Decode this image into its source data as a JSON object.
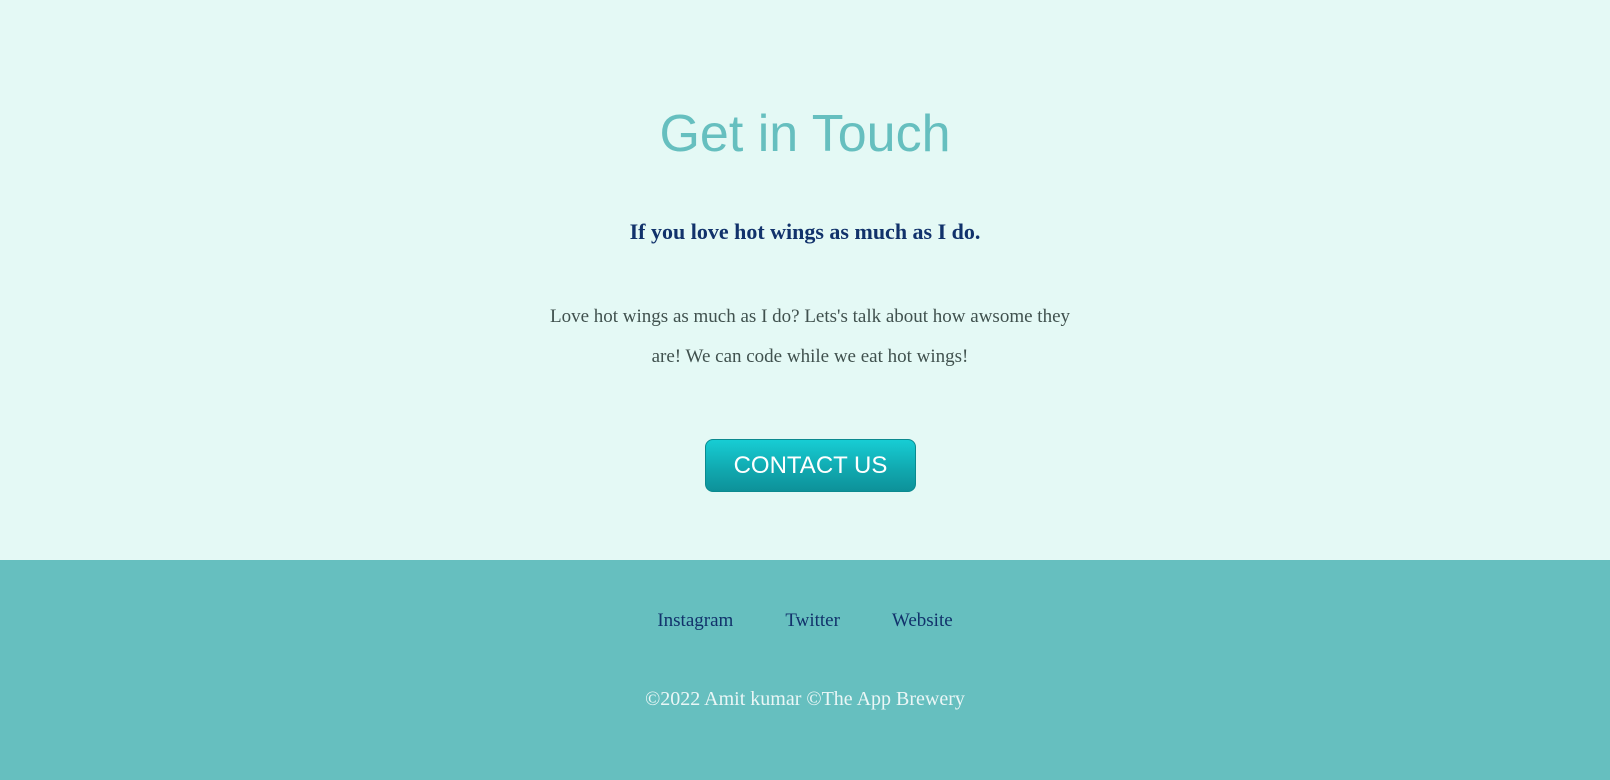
{
  "contact": {
    "title": "Get in Touch",
    "subtitle": "If you love hot wings as much as I do.",
    "body_line1": "Love hot wings as much as I do? Lets's talk about how awsome they",
    "body_line2": "are! We can code while we eat hot wings!",
    "button_label": "CONTACT US"
  },
  "footer": {
    "links": [
      "Instagram",
      "Twitter",
      "Website"
    ],
    "copyright": "©2022 Amit kumar ©The App Brewery"
  },
  "colors": {
    "background": "#e4f9f5",
    "title": "#66bfbf",
    "subtitle": "#11326b",
    "body_text": "#40514e",
    "button": "#11aab1",
    "footer_background": "#66bfbf",
    "footer_link": "#11326b",
    "copyright": "#eaf6f6"
  }
}
